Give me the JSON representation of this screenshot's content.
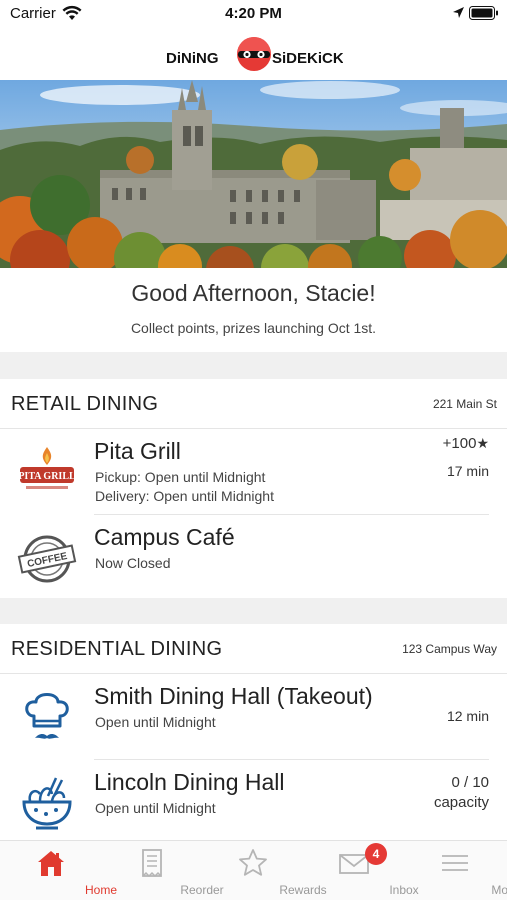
{
  "status": {
    "carrier": "Carrier",
    "time": "4:20 PM"
  },
  "header": {
    "logo_text_left": "DiNiNG",
    "logo_text_right": "SiDEKiCK"
  },
  "greeting": {
    "title": "Good Afternoon, Stacie!",
    "subtitle": "Collect points, prizes launching Oct 1st."
  },
  "retail": {
    "title": "RETAIL DINING",
    "address": "221 Main St",
    "items": [
      {
        "name": "Pita Grill",
        "line1": "Pickup: Open until Midnight",
        "line2": "Delivery: Open until Midnight",
        "points": "+100",
        "wait": "17 min",
        "logo_text": "PITA GRILL"
      },
      {
        "name": "Campus Café",
        "line1": "Now Closed",
        "logo_text": "COFFEE"
      }
    ]
  },
  "residential": {
    "title": "RESIDENTIAL DINING",
    "address": "123 Campus Way",
    "items": [
      {
        "name": "Smith Dining Hall (Takeout)",
        "line1": "Open until Midnight",
        "wait": "12 min"
      },
      {
        "name": "Lincoln Dining Hall",
        "line1": "Open until Midnight",
        "capacity": "0 / 10",
        "capacity_label": "capacity"
      }
    ]
  },
  "tabs": [
    {
      "label": "Home",
      "icon": "home-icon",
      "active": true
    },
    {
      "label": "Reorder",
      "icon": "receipt-icon"
    },
    {
      "label": "Rewards",
      "icon": "star-icon"
    },
    {
      "label": "Inbox",
      "icon": "mail-icon",
      "badge": "4"
    },
    {
      "label": "More",
      "icon": "menu-icon"
    }
  ],
  "colors": {
    "accent": "#e03a2f",
    "badge": "#e53935",
    "inactive_tab": "#999999",
    "section_bg": "#f0f0f0"
  }
}
